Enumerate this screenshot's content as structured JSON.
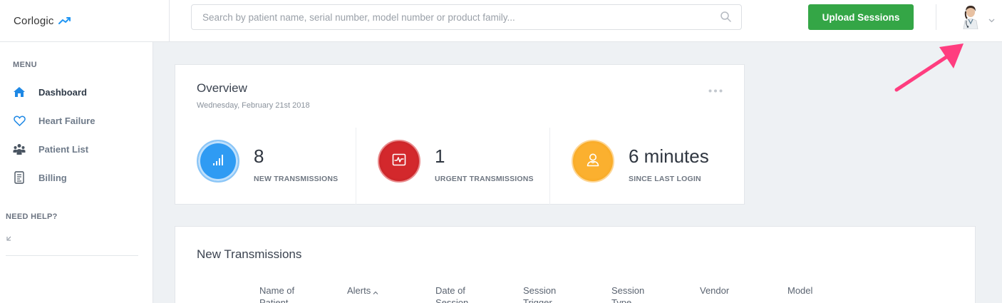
{
  "header": {
    "brand_name": "Corlogic",
    "search_placeholder": "Search by patient name, serial number, model number or product family...",
    "upload_label": "Upload Sessions"
  },
  "sidebar": {
    "menu_title": "MENU",
    "items": [
      {
        "label": "Dashboard",
        "icon": "home-icon",
        "active": true
      },
      {
        "label": "Heart Failure",
        "icon": "heart-icon",
        "active": false
      },
      {
        "label": "Patient List",
        "icon": "users-icon",
        "active": false
      },
      {
        "label": "Billing",
        "icon": "billing-icon",
        "active": false
      }
    ],
    "help_title": "NEED HELP?"
  },
  "overview": {
    "title": "Overview",
    "date": "Wednesday, February 21st 2018",
    "stats": [
      {
        "value": "8",
        "label": "NEW TRANSMISSIONS",
        "icon": "signal-bars-icon",
        "color": "#2196f3"
      },
      {
        "value": "1",
        "label": "URGENT TRANSMISSIONS",
        "icon": "heartbeat-icon",
        "color": "#c62828"
      },
      {
        "value": "6 minutes",
        "label": "SINCE LAST LOGIN",
        "icon": "doctor-icon",
        "color": "#f9a825"
      }
    ]
  },
  "new_transmissions": {
    "title": "New Transmissions",
    "columns": [
      {
        "line1": "Name of",
        "line2": "Patient"
      },
      {
        "line1": "Alerts",
        "line2": ""
      },
      {
        "line1": "Date of",
        "line2": "Session"
      },
      {
        "line1": "Session",
        "line2": "Trigger"
      },
      {
        "line1": "Session",
        "line2": "Type"
      },
      {
        "line1": "Vendor",
        "line2": ""
      },
      {
        "line1": "Model",
        "line2": ""
      }
    ]
  },
  "colors": {
    "accent_green": "#34a646",
    "arrow_pink": "#ff3d7f",
    "background": "#eef1f4"
  }
}
